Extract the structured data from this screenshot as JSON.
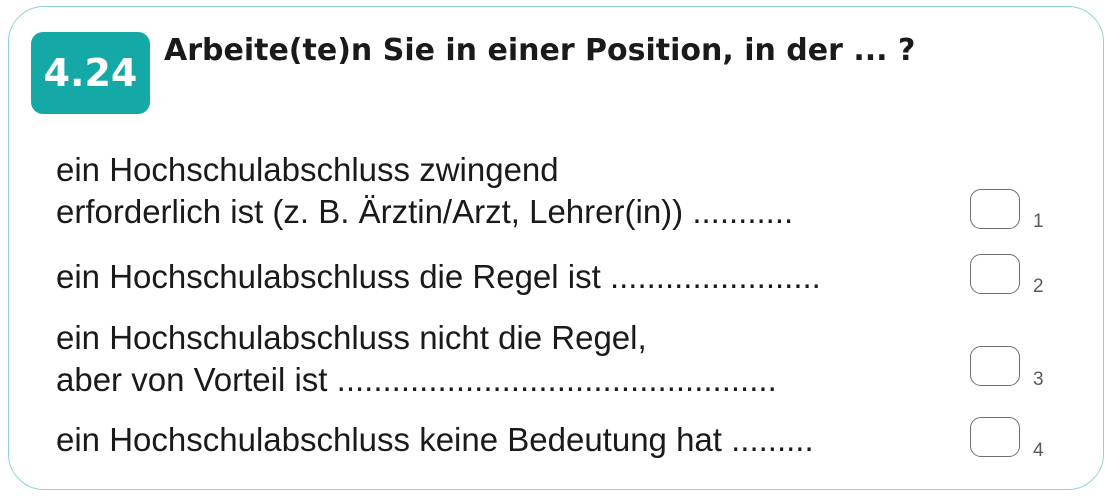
{
  "question": {
    "number": "4.24",
    "text": "Arbeite(te)n Sie in einer Position, in der ... ?"
  },
  "options": [
    {
      "lines": [
        "ein Hochschulabschluss zwingend",
        "erforderlich ist (z. B. Ärztin/Arzt, Lehrer(in)) ..........."
      ],
      "code": "1"
    },
    {
      "lines": [
        "ein Hochschulabschluss die Regel ist ......................."
      ],
      "code": "2"
    },
    {
      "lines": [
        "ein Hochschulabschluss nicht die Regel,",
        "aber von Vorteil ist ................................................"
      ],
      "code": "3"
    },
    {
      "lines": [
        "ein Hochschulabschluss keine Bedeutung hat ........."
      ],
      "code": "4"
    }
  ]
}
